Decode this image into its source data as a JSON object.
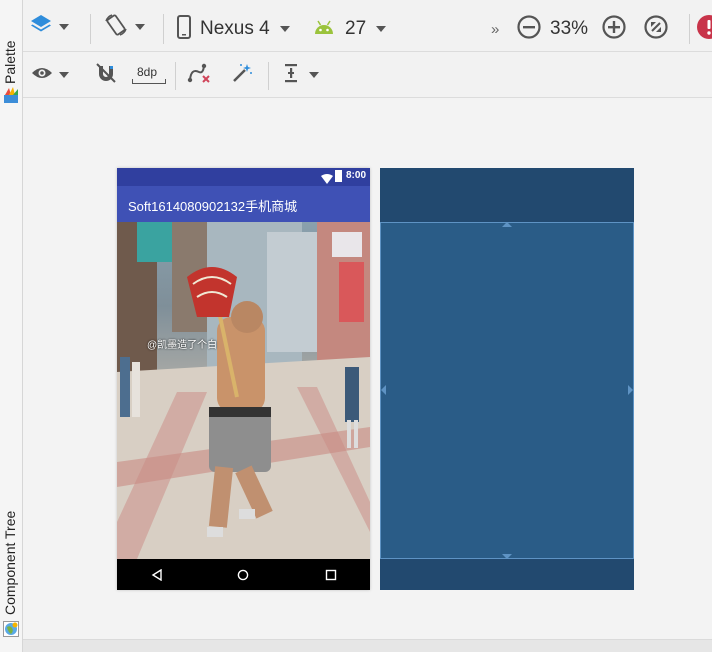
{
  "left_panel": {
    "palette_label": "Palette",
    "component_tree_label": "Component Tree"
  },
  "toolbar_top": {
    "design_surface_icon": "layers-icon",
    "orientation_icon": "rotate-device-icon",
    "device_name": "Nexus 4",
    "api_level": "27",
    "overflow_icon": "double-chevron-right-icon",
    "zoom_out_icon": "zoom-out-icon",
    "zoom_level": "33%",
    "zoom_in_icon": "zoom-in-icon",
    "zoom_fit_icon": "zoom-fit-icon",
    "error_icon": "error-icon"
  },
  "toolbar_layout": {
    "view_options_icon": "eye-icon",
    "autoconnect_icon": "magnet-off-icon",
    "default_margin": "8dp",
    "clear_constraints_icon": "clear-constraints-icon",
    "infer_constraints_icon": "magic-wand-icon",
    "guidelines_icon": "guidelines-icon"
  },
  "design_preview": {
    "status_time": "8:00",
    "app_title": "Soft1614080902132手机商城",
    "photo_watermark": "@凯墨造了个白"
  },
  "colors": {
    "status_bar": "#303f9f",
    "app_bar": "#3f51b5",
    "blueprint_bg": "#22496f",
    "blueprint_inner": "#2a5c87"
  }
}
